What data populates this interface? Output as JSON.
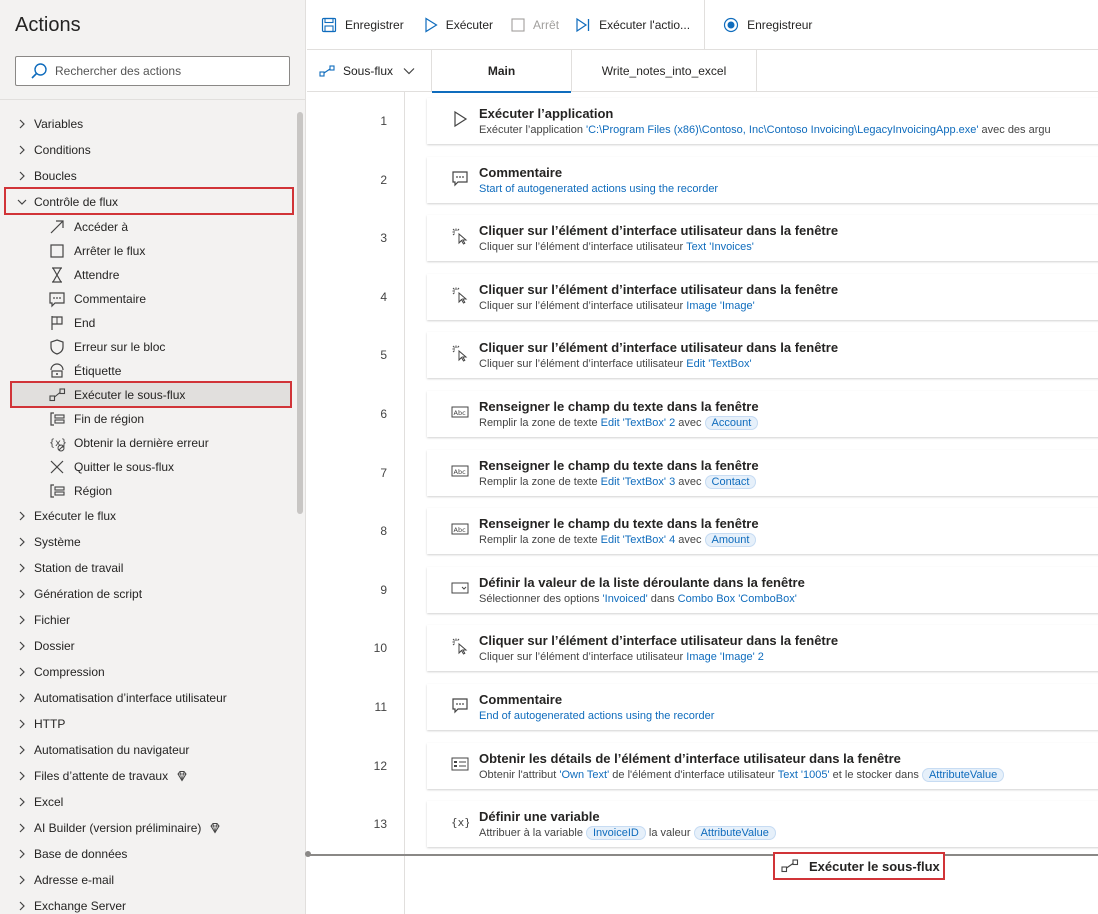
{
  "left_panel": {
    "title": "Actions",
    "search_placeholder": "Rechercher des actions",
    "categories_top": [
      {
        "label": "Variables"
      },
      {
        "label": "Conditions"
      },
      {
        "label": "Boucles"
      }
    ],
    "open_category": {
      "label": "Contrôle de flux"
    },
    "subitems": [
      {
        "label": "Accéder à",
        "icon": "arrow-icon"
      },
      {
        "label": "Arrêter le flux",
        "icon": "stop-icon"
      },
      {
        "label": "Attendre",
        "icon": "hourglass-icon"
      },
      {
        "label": "Commentaire",
        "icon": "comment-icon"
      },
      {
        "label": "End",
        "icon": "flag-icon"
      },
      {
        "label": "Erreur sur le bloc",
        "icon": "shield-icon"
      },
      {
        "label": "Étiquette",
        "icon": "label-icon"
      },
      {
        "label": "Exécuter le sous-flux",
        "icon": "subflow-icon"
      },
      {
        "label": "Fin de région",
        "icon": "region-icon"
      },
      {
        "label": "Obtenir la dernière erreur",
        "icon": "variable-error-icon"
      },
      {
        "label": "Quitter le sous-flux",
        "icon": "close-icon"
      },
      {
        "label": "Région",
        "icon": "region-icon"
      }
    ],
    "categories_bottom": [
      {
        "label": "Exécuter le flux",
        "premium": false
      },
      {
        "label": "Système",
        "premium": false
      },
      {
        "label": "Station de travail",
        "premium": false
      },
      {
        "label": "Génération de script",
        "premium": false
      },
      {
        "label": "Fichier",
        "premium": false
      },
      {
        "label": "Dossier",
        "premium": false
      },
      {
        "label": "Compression",
        "premium": false
      },
      {
        "label": "Automatisation d’interface utilisateur",
        "premium": false
      },
      {
        "label": "HTTP",
        "premium": false
      },
      {
        "label": "Automatisation du navigateur",
        "premium": false
      },
      {
        "label": "Files d’attente de travaux",
        "premium": true
      },
      {
        "label": "Excel",
        "premium": false
      },
      {
        "label": "AI Builder (version préliminaire)",
        "premium": true
      },
      {
        "label": "Base de données",
        "premium": false
      },
      {
        "label": "Adresse e-mail",
        "premium": false
      },
      {
        "label": "Exchange Server",
        "premium": false
      }
    ]
  },
  "toolbar": {
    "save": "Enregistrer",
    "run": "Exécuter",
    "stop": "Arrêt",
    "run_action": "Exécuter l'actio...",
    "recorder": "Enregistreur"
  },
  "tabs": {
    "subflows": "Sous-flux",
    "items": [
      "Main",
      "Write_notes_into_excel"
    ]
  },
  "actions": [
    {
      "num": "1",
      "title": "Exécuter l’application",
      "icon": "play-icon",
      "parts": [
        [
          "t",
          "Exécuter l’application "
        ],
        [
          "l",
          "'C:\\Program Files (x86)\\Contoso, Inc\\Contoso Invoicing\\LegacyInvoicingApp.exe'"
        ],
        [
          "t",
          " avec des argu"
        ]
      ]
    },
    {
      "num": "2",
      "title": "Commentaire",
      "icon": "comment-icon",
      "parts": [
        [
          "l",
          "Start of autogenerated actions using the recorder"
        ]
      ]
    },
    {
      "num": "3",
      "title": "Cliquer sur l’élément d’interface utilisateur dans la fenêtre",
      "icon": "click-icon",
      "parts": [
        [
          "t",
          "Cliquer sur l’élément d’interface utilisateur "
        ],
        [
          "l",
          "Text 'Invoices'"
        ]
      ]
    },
    {
      "num": "4",
      "title": "Cliquer sur l’élément d’interface utilisateur dans la fenêtre",
      "icon": "click-icon",
      "parts": [
        [
          "t",
          "Cliquer sur l’élément d’interface utilisateur "
        ],
        [
          "l",
          "Image 'Image'"
        ]
      ]
    },
    {
      "num": "5",
      "title": "Cliquer sur l’élément d’interface utilisateur dans la fenêtre",
      "icon": "click-icon",
      "parts": [
        [
          "t",
          "Cliquer sur l’élément d’interface utilisateur "
        ],
        [
          "l",
          "Edit 'TextBox'"
        ]
      ]
    },
    {
      "num": "6",
      "title": "Renseigner le champ du texte dans la fenêtre",
      "icon": "textfield-icon",
      "parts": [
        [
          "t",
          "Remplir la zone de texte "
        ],
        [
          "l",
          "Edit 'TextBox' 2"
        ],
        [
          "t",
          " avec "
        ],
        [
          "v",
          "Account"
        ]
      ]
    },
    {
      "num": "7",
      "title": "Renseigner le champ du texte dans la fenêtre",
      "icon": "textfield-icon",
      "parts": [
        [
          "t",
          "Remplir la zone de texte "
        ],
        [
          "l",
          "Edit 'TextBox' 3"
        ],
        [
          "t",
          " avec "
        ],
        [
          "v",
          "Contact"
        ]
      ]
    },
    {
      "num": "8",
      "title": "Renseigner le champ du texte dans la fenêtre",
      "icon": "textfield-icon",
      "parts": [
        [
          "t",
          "Remplir la zone de texte "
        ],
        [
          "l",
          "Edit 'TextBox' 4"
        ],
        [
          "t",
          " avec "
        ],
        [
          "v",
          "Amount"
        ]
      ]
    },
    {
      "num": "9",
      "title": "Définir la valeur de la liste déroulante dans la fenêtre",
      "icon": "dropdown-icon",
      "parts": [
        [
          "t",
          "Sélectionner des options "
        ],
        [
          "l",
          "'Invoiced'"
        ],
        [
          "t",
          " dans "
        ],
        [
          "l",
          "Combo Box 'ComboBox'"
        ]
      ]
    },
    {
      "num": "10",
      "title": "Cliquer sur l’élément d’interface utilisateur dans la fenêtre",
      "icon": "click-icon",
      "parts": [
        [
          "t",
          "Cliquer sur l’élément d’interface utilisateur "
        ],
        [
          "l",
          "Image 'Image' 2"
        ]
      ]
    },
    {
      "num": "11",
      "title": "Commentaire",
      "icon": "comment-icon",
      "parts": [
        [
          "l",
          "End of autogenerated actions using the recorder"
        ]
      ]
    },
    {
      "num": "12",
      "title": "Obtenir les détails de l’élément d’interface utilisateur dans la fenêtre",
      "icon": "details-icon",
      "parts": [
        [
          "t",
          "Obtenir l'attribut "
        ],
        [
          "l",
          "'Own Text'"
        ],
        [
          "t",
          " de l'élément d'interface utilisateur "
        ],
        [
          "l",
          "Text '1005'"
        ],
        [
          "t",
          " et le stocker dans "
        ],
        [
          "v",
          "AttributeValue"
        ]
      ]
    },
    {
      "num": "13",
      "title": "Définir une variable",
      "icon": "variable-icon",
      "parts": [
        [
          "t",
          "Attribuer à la variable "
        ],
        [
          "v",
          "InvoiceID"
        ],
        [
          "t",
          " la valeur "
        ],
        [
          "v",
          "AttributeValue"
        ]
      ]
    }
  ],
  "drag_ghost": {
    "label": "Exécuter le sous-flux",
    "icon": "subflow-icon"
  },
  "colors": {
    "accent": "#0f6cbd",
    "highlight": "#d13438"
  }
}
